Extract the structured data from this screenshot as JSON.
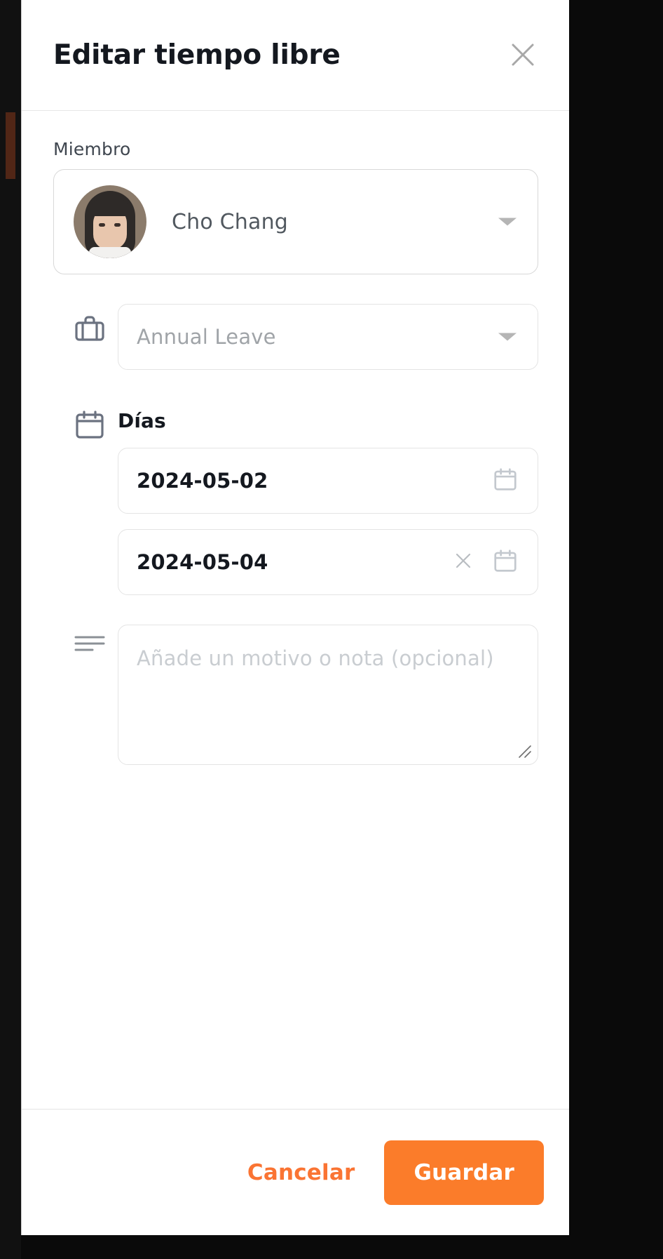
{
  "modal": {
    "title": "Editar tiempo libre",
    "close_icon": "close-icon"
  },
  "member": {
    "label": "Miembro",
    "name": "Cho Chang",
    "avatar_bg": "#8b7b6b",
    "caret_icon": "chevron-down-icon"
  },
  "leave_type": {
    "icon": "briefcase-icon",
    "value": "Annual Leave",
    "caret_icon": "chevron-down-icon"
  },
  "days": {
    "icon": "calendar-icon",
    "label": "Días",
    "entries": [
      {
        "value": "2024-05-02",
        "has_clear": false,
        "calendar_icon": "calendar-icon"
      },
      {
        "value": "2024-05-04",
        "has_clear": true,
        "clear_icon": "close-icon",
        "calendar_icon": "calendar-icon"
      }
    ]
  },
  "note": {
    "icon": "note-lines-icon",
    "placeholder": "Añade un motivo o nota (opcional)",
    "value": "",
    "resize_icon": "resize-grip-icon"
  },
  "footer": {
    "cancel_label": "Cancelar",
    "save_label": "Guardar"
  },
  "colors": {
    "accent": "#fb7c2a",
    "cancel_text": "#fa7433",
    "title_text": "#14181f",
    "muted_text": "#a0a4a8",
    "border": "#e4e4e4"
  }
}
